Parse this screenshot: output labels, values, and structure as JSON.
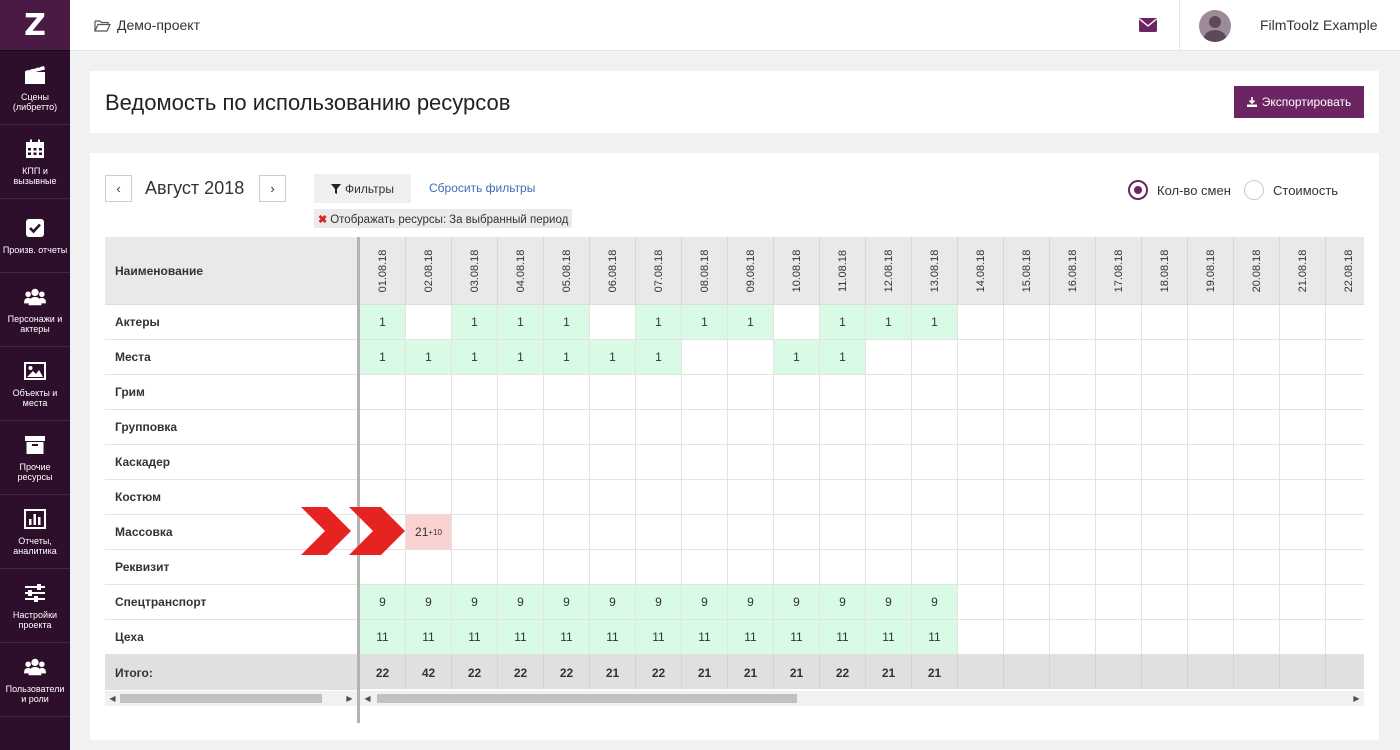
{
  "app": {
    "logo": "Z"
  },
  "sidebar": {
    "items": [
      {
        "label": "Сцены (либретто)",
        "icon": "clapperboard-icon"
      },
      {
        "label": "КПП и вызывные",
        "icon": "calendar-icon"
      },
      {
        "label": "Произв. отчеты",
        "icon": "checkbox-icon"
      },
      {
        "label": "Персонажи и актеры",
        "icon": "people-icon"
      },
      {
        "label": "Объекты и места",
        "icon": "image-icon"
      },
      {
        "label": "Прочие ресурсы",
        "icon": "archive-icon"
      },
      {
        "label": "Отчеты, аналитика",
        "icon": "bar-chart-icon"
      },
      {
        "label": "Настройки проекта",
        "icon": "sliders-icon"
      },
      {
        "label": "Пользователи и роли",
        "icon": "users-icon"
      }
    ]
  },
  "topbar": {
    "project": "Демо-проект",
    "username": "FilmToolz Example"
  },
  "header": {
    "title": "Ведомость по использованию ресурсов",
    "export_label": "Экспортировать"
  },
  "toolbar": {
    "prev": "‹",
    "next": "›",
    "month": "Август 2018",
    "filters_label": "Фильтры",
    "reset_label": "Сбросить фильтры",
    "tag_label": "Отображать ресурсы:",
    "tag_value": "За выбранный период",
    "radio_shifts": "Кол-во смен",
    "radio_cost": "Стоимость",
    "selected": "shifts"
  },
  "table": {
    "name_header": "Наименование",
    "total_label": "Итого:",
    "dates": [
      "01.08.18",
      "02.08.18",
      "03.08.18",
      "04.08.18",
      "05.08.18",
      "06.08.18",
      "07.08.18",
      "08.08.18",
      "09.08.18",
      "10.08.18",
      "11.08.18",
      "12.08.18",
      "13.08.18",
      "14.08.18",
      "15.08.18",
      "16.08.18",
      "17.08.18",
      "18.08.18",
      "19.08.18",
      "20.08.18",
      "21.08.18",
      "22.08.18"
    ],
    "rows": [
      {
        "name": "Актеры",
        "cells": [
          "1",
          "",
          "1",
          "1",
          "1",
          "",
          "1",
          "1",
          "1",
          "",
          "1",
          "1",
          "1",
          "",
          "",
          "",
          "",
          "",
          "",
          "",
          "",
          ""
        ],
        "fill": "green"
      },
      {
        "name": "Места",
        "cells": [
          "1",
          "1",
          "1",
          "1",
          "1",
          "1",
          "1",
          "",
          "",
          "1",
          "1",
          "",
          "",
          "",
          "",
          "",
          "",
          "",
          "",
          "",
          "",
          ""
        ],
        "fill": "green"
      },
      {
        "name": "Грим",
        "cells": [
          "",
          "",
          "",
          "",
          "",
          "",
          "",
          "",
          "",
          "",
          "",
          "",
          "",
          "",
          "",
          "",
          "",
          "",
          "",
          "",
          "",
          ""
        ]
      },
      {
        "name": "Групповка",
        "cells": [
          "",
          "",
          "",
          "",
          "",
          "",
          "",
          "",
          "",
          "",
          "",
          "",
          "",
          "",
          "",
          "",
          "",
          "",
          "",
          "",
          "",
          ""
        ]
      },
      {
        "name": "Каскадер",
        "cells": [
          "",
          "",
          "",
          "",
          "",
          "",
          "",
          "",
          "",
          "",
          "",
          "",
          "",
          "",
          "",
          "",
          "",
          "",
          "",
          "",
          "",
          ""
        ]
      },
      {
        "name": "Костюм",
        "cells": [
          "",
          "",
          "",
          "",
          "",
          "",
          "",
          "",
          "",
          "",
          "",
          "",
          "",
          "",
          "",
          "",
          "",
          "",
          "",
          "",
          "",
          ""
        ]
      },
      {
        "name": "Массовка",
        "cells": [
          "",
          "21",
          "",
          "",
          "",
          "",
          "",
          "",
          "",
          "",
          "",
          "",
          "",
          "",
          "",
          "",
          "",
          "",
          "",
          "",
          "",
          ""
        ],
        "overflow": {
          "index": 1,
          "extra": "+10"
        }
      },
      {
        "name": "Реквизит",
        "cells": [
          "",
          "",
          "",
          "",
          "",
          "",
          "",
          "",
          "",
          "",
          "",
          "",
          "",
          "",
          "",
          "",
          "",
          "",
          "",
          "",
          "",
          ""
        ]
      },
      {
        "name": "Спецтранспорт",
        "cells": [
          "9",
          "9",
          "9",
          "9",
          "9",
          "9",
          "9",
          "9",
          "9",
          "9",
          "9",
          "9",
          "9",
          "",
          "",
          "",
          "",
          "",
          "",
          "",
          "",
          ""
        ],
        "fill": "green"
      },
      {
        "name": "Цеха",
        "cells": [
          "11",
          "11",
          "11",
          "11",
          "11",
          "11",
          "11",
          "11",
          "11",
          "11",
          "11",
          "11",
          "11",
          "",
          "",
          "",
          "",
          "",
          "",
          "",
          "",
          ""
        ],
        "fill": "green"
      }
    ],
    "totals": [
      "22",
      "42",
      "22",
      "22",
      "22",
      "21",
      "22",
      "21",
      "21",
      "21",
      "22",
      "21",
      "21",
      "",
      "",
      "",
      "",
      "",
      "",
      "",
      "",
      ""
    ]
  },
  "colors": {
    "sidebar": "#2e0f2b",
    "accent": "#6b2563",
    "cell_ok": "#d9fbe6",
    "cell_over": "#fbd2d2",
    "arrow": "#e52421",
    "link": "#3b6fb6"
  }
}
